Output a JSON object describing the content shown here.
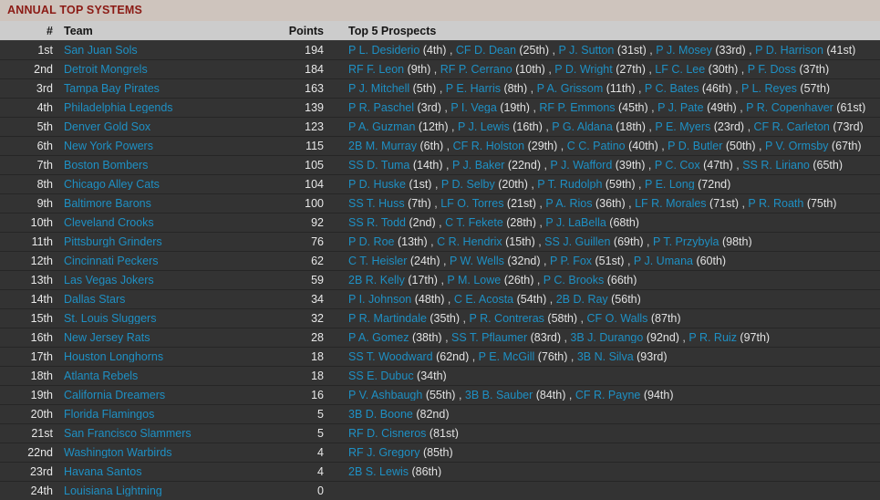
{
  "header": {
    "title": "ANNUAL TOP SYSTEMS"
  },
  "columns": {
    "rank": "#",
    "team": "Team",
    "points": "Points",
    "prospects": "Top 5 Prospects"
  },
  "rows": [
    {
      "rank": "1st",
      "team": "San Juan Sols",
      "points": "194",
      "prospects": [
        {
          "player": "P L. Desiderio",
          "ord": "(4th)"
        },
        {
          "player": "CF D. Dean",
          "ord": "(25th)"
        },
        {
          "player": "P J. Sutton",
          "ord": "(31st)"
        },
        {
          "player": "P J. Mosey",
          "ord": "(33rd)"
        },
        {
          "player": "P D. Harrison",
          "ord": "(41st)"
        }
      ]
    },
    {
      "rank": "2nd",
      "team": "Detroit Mongrels",
      "points": "184",
      "prospects": [
        {
          "player": "RF F. Leon",
          "ord": "(9th)"
        },
        {
          "player": "RF P. Cerrano",
          "ord": "(10th)"
        },
        {
          "player": "P D. Wright",
          "ord": "(27th)"
        },
        {
          "player": "LF C. Lee",
          "ord": "(30th)"
        },
        {
          "player": "P F. Doss",
          "ord": "(37th)"
        }
      ]
    },
    {
      "rank": "3rd",
      "team": "Tampa Bay Pirates",
      "points": "163",
      "prospects": [
        {
          "player": "P J. Mitchell",
          "ord": "(5th)"
        },
        {
          "player": "P E. Harris",
          "ord": "(8th)"
        },
        {
          "player": "P A. Grissom",
          "ord": "(11th)"
        },
        {
          "player": "P C. Bates",
          "ord": "(46th)"
        },
        {
          "player": "P L. Reyes",
          "ord": "(57th)"
        }
      ]
    },
    {
      "rank": "4th",
      "team": "Philadelphia Legends",
      "points": "139",
      "prospects": [
        {
          "player": "P R. Paschel",
          "ord": "(3rd)"
        },
        {
          "player": "P I. Vega",
          "ord": "(19th)"
        },
        {
          "player": "RF P. Emmons",
          "ord": "(45th)"
        },
        {
          "player": "P J. Pate",
          "ord": "(49th)"
        },
        {
          "player": "P R. Copenhaver",
          "ord": "(61st)"
        }
      ]
    },
    {
      "rank": "5th",
      "team": "Denver Gold Sox",
      "points": "123",
      "prospects": [
        {
          "player": "P A. Guzman",
          "ord": "(12th)"
        },
        {
          "player": "P J. Lewis",
          "ord": "(16th)"
        },
        {
          "player": "P G. Aldana",
          "ord": "(18th)"
        },
        {
          "player": "P E. Myers",
          "ord": "(23rd)"
        },
        {
          "player": "CF R. Carleton",
          "ord": "(73rd)"
        }
      ]
    },
    {
      "rank": "6th",
      "team": "New York Powers",
      "points": "115",
      "prospects": [
        {
          "player": "2B M. Murray",
          "ord": "(6th)"
        },
        {
          "player": "CF R. Holston",
          "ord": "(29th)"
        },
        {
          "player": "C C. Patino",
          "ord": "(40th)"
        },
        {
          "player": "P D. Butler",
          "ord": "(50th)"
        },
        {
          "player": "P V. Ormsby",
          "ord": "(67th)"
        }
      ]
    },
    {
      "rank": "7th",
      "team": "Boston Bombers",
      "points": "105",
      "prospects": [
        {
          "player": "SS D. Tuma",
          "ord": "(14th)"
        },
        {
          "player": "P J. Baker",
          "ord": "(22nd)"
        },
        {
          "player": "P J. Wafford",
          "ord": "(39th)"
        },
        {
          "player": "P C. Cox",
          "ord": "(47th)"
        },
        {
          "player": "SS R. Liriano",
          "ord": "(65th)"
        }
      ]
    },
    {
      "rank": "8th",
      "team": "Chicago Alley Cats",
      "points": "104",
      "prospects": [
        {
          "player": "P D. Huske",
          "ord": "(1st)"
        },
        {
          "player": "P D. Selby",
          "ord": "(20th)"
        },
        {
          "player": "P T. Rudolph",
          "ord": "(59th)"
        },
        {
          "player": "P E. Long",
          "ord": "(72nd)"
        }
      ]
    },
    {
      "rank": "9th",
      "team": "Baltimore Barons",
      "points": "100",
      "prospects": [
        {
          "player": "SS T. Huss",
          "ord": "(7th)"
        },
        {
          "player": "LF O. Torres",
          "ord": "(21st)"
        },
        {
          "player": "P A. Rios",
          "ord": "(36th)"
        },
        {
          "player": "LF R. Morales",
          "ord": "(71st)"
        },
        {
          "player": "P R. Roath",
          "ord": "(75th)"
        }
      ]
    },
    {
      "rank": "10th",
      "team": "Cleveland Crooks",
      "points": "92",
      "prospects": [
        {
          "player": "SS R. Todd",
          "ord": "(2nd)"
        },
        {
          "player": "C T. Fekete",
          "ord": "(28th)"
        },
        {
          "player": "P J. LaBella",
          "ord": "(68th)"
        }
      ]
    },
    {
      "rank": "11th",
      "team": "Pittsburgh Grinders",
      "points": "76",
      "prospects": [
        {
          "player": "P D. Roe",
          "ord": "(13th)"
        },
        {
          "player": "C R. Hendrix",
          "ord": "(15th)"
        },
        {
          "player": "SS J. Guillen",
          "ord": "(69th)"
        },
        {
          "player": "P T. Przybyla",
          "ord": "(98th)"
        }
      ]
    },
    {
      "rank": "12th",
      "team": "Cincinnati Peckers",
      "points": "62",
      "prospects": [
        {
          "player": "C T. Heisler",
          "ord": "(24th)"
        },
        {
          "player": "P W. Wells",
          "ord": "(32nd)"
        },
        {
          "player": "P P. Fox",
          "ord": "(51st)"
        },
        {
          "player": "P J. Umana",
          "ord": "(60th)"
        }
      ]
    },
    {
      "rank": "13th",
      "team": "Las Vegas Jokers",
      "points": "59",
      "prospects": [
        {
          "player": "2B R. Kelly",
          "ord": "(17th)"
        },
        {
          "player": "P M. Lowe",
          "ord": "(26th)"
        },
        {
          "player": "P C. Brooks",
          "ord": "(66th)"
        }
      ]
    },
    {
      "rank": "14th",
      "team": "Dallas Stars",
      "points": "34",
      "prospects": [
        {
          "player": "P I. Johnson",
          "ord": "(48th)"
        },
        {
          "player": "C E. Acosta",
          "ord": "(54th)"
        },
        {
          "player": "2B D. Ray",
          "ord": "(56th)"
        }
      ]
    },
    {
      "rank": "15th",
      "team": "St. Louis Sluggers",
      "points": "32",
      "prospects": [
        {
          "player": "P R. Martindale",
          "ord": "(35th)"
        },
        {
          "player": "P R. Contreras",
          "ord": "(58th)"
        },
        {
          "player": "CF O. Walls",
          "ord": "(87th)"
        }
      ]
    },
    {
      "rank": "16th",
      "team": "New Jersey Rats",
      "points": "28",
      "prospects": [
        {
          "player": "P A. Gomez",
          "ord": "(38th)"
        },
        {
          "player": "SS T. Pflaumer",
          "ord": "(83rd)"
        },
        {
          "player": "3B J. Durango",
          "ord": "(92nd)"
        },
        {
          "player": "P R. Ruiz",
          "ord": "(97th)"
        }
      ]
    },
    {
      "rank": "17th",
      "team": "Houston Longhorns",
      "points": "18",
      "prospects": [
        {
          "player": "SS T. Woodward",
          "ord": "(62nd)"
        },
        {
          "player": "P E. McGill",
          "ord": "(76th)"
        },
        {
          "player": "3B N. Silva",
          "ord": "(93rd)"
        }
      ]
    },
    {
      "rank": "18th",
      "team": "Atlanta Rebels",
      "points": "18",
      "prospects": [
        {
          "player": "SS E. Dubuc",
          "ord": "(34th)"
        }
      ]
    },
    {
      "rank": "19th",
      "team": "California Dreamers",
      "points": "16",
      "prospects": [
        {
          "player": "P V. Ashbaugh",
          "ord": "(55th)"
        },
        {
          "player": "3B B. Sauber",
          "ord": "(84th)"
        },
        {
          "player": "CF R. Payne",
          "ord": "(94th)"
        }
      ]
    },
    {
      "rank": "20th",
      "team": "Florida Flamingos",
      "points": "5",
      "prospects": [
        {
          "player": "3B D. Boone",
          "ord": "(82nd)"
        }
      ]
    },
    {
      "rank": "21st",
      "team": "San Francisco Slammers",
      "points": "5",
      "prospects": [
        {
          "player": "RF D. Cisneros",
          "ord": "(81st)"
        }
      ]
    },
    {
      "rank": "22nd",
      "team": "Washington Warbirds",
      "points": "4",
      "prospects": [
        {
          "player": "RF J. Gregory",
          "ord": "(85th)"
        }
      ]
    },
    {
      "rank": "23rd",
      "team": "Havana Santos",
      "points": "4",
      "prospects": [
        {
          "player": "2B S. Lewis",
          "ord": "(86th)"
        }
      ]
    },
    {
      "rank": "24th",
      "team": "Louisiana Lightning",
      "points": "0",
      "prospects": []
    }
  ],
  "colors": {
    "title_bar_bg": "#cec4bd",
    "title_text": "#8b1a14",
    "col_head_bg": "#cccccc",
    "row_bg": "#333333",
    "link": "#1e90c4",
    "text": "#e8e8e8"
  }
}
